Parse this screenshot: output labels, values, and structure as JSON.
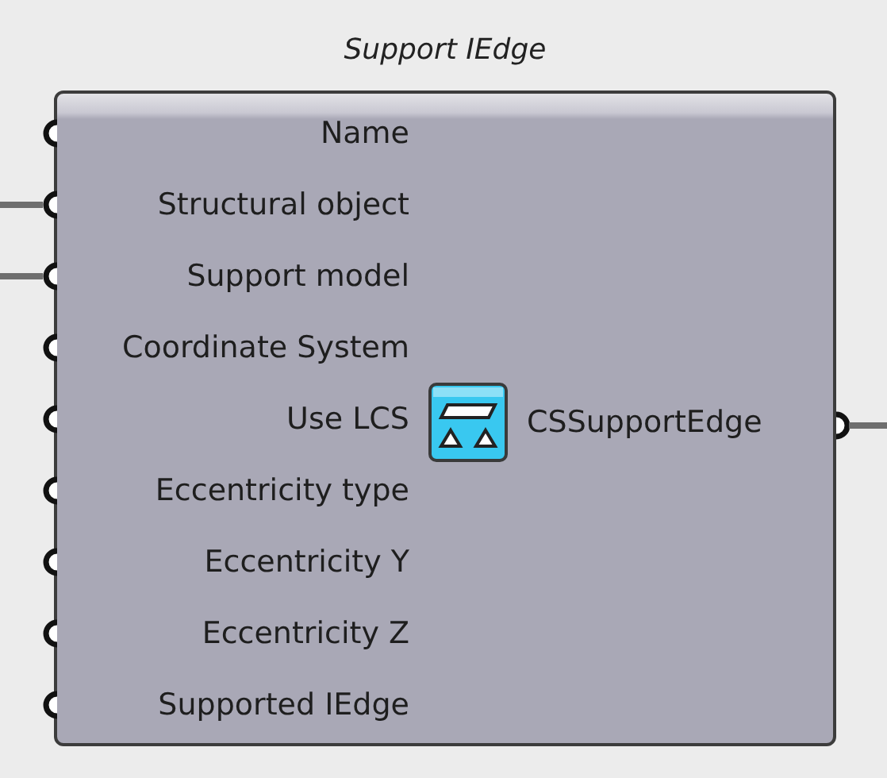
{
  "component": {
    "title": "Support IEdge",
    "inputs": [
      {
        "label": "Name",
        "connected": false
      },
      {
        "label": "Structural object",
        "connected": true
      },
      {
        "label": "Support model",
        "connected": true
      },
      {
        "label": "Coordinate System",
        "connected": false
      },
      {
        "label": "Use LCS",
        "connected": false
      },
      {
        "label": "Eccentricity type",
        "connected": false
      },
      {
        "label": "Eccentricity Y",
        "connected": false
      },
      {
        "label": "Eccentricity Z",
        "connected": false
      },
      {
        "label": "Supported IEdge",
        "connected": false
      }
    ],
    "output": {
      "label": "CSSupportEdge",
      "connected": true
    }
  }
}
